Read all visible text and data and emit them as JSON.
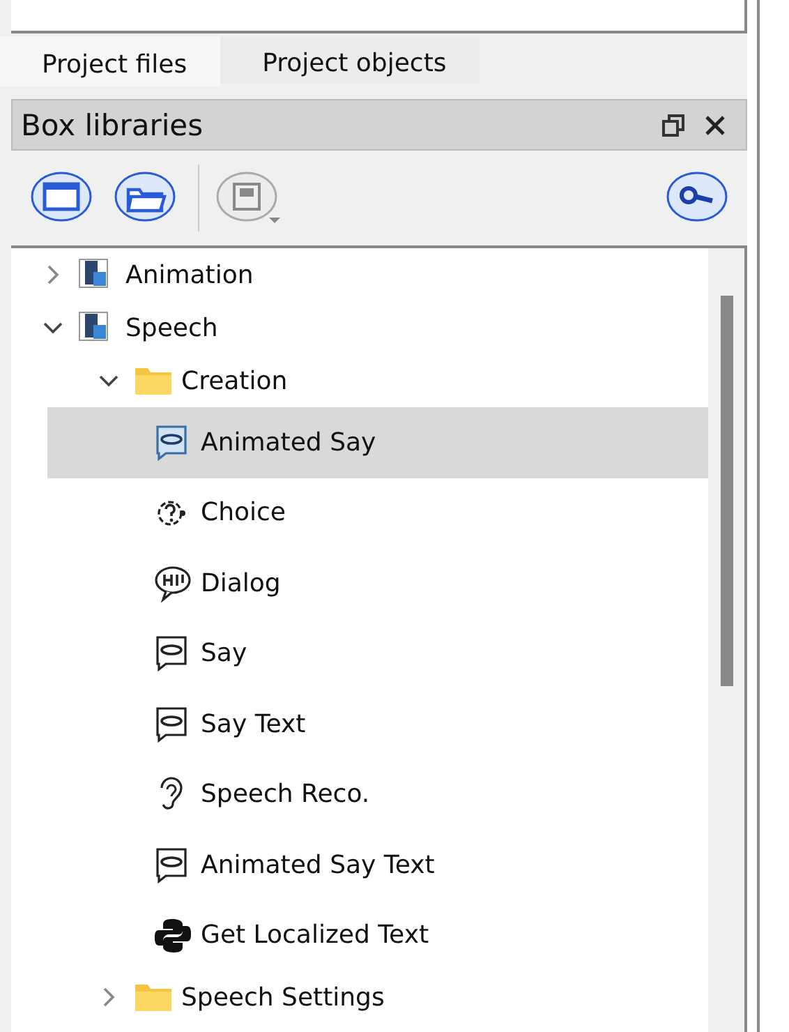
{
  "tabs": [
    {
      "label": "Project files",
      "selected": true
    },
    {
      "label": "Project objects",
      "selected": false
    }
  ],
  "panel": {
    "title": "Box libraries"
  },
  "toolbar": [
    {
      "kind": "new",
      "disabled": false
    },
    {
      "kind": "open",
      "disabled": false
    },
    {
      "kind": "save",
      "disabled": true
    },
    {
      "kind": "search",
      "disabled": false
    }
  ],
  "tree": {
    "items": [
      {
        "label": "Animation",
        "kind": "library",
        "expanded": false,
        "selected": false
      },
      {
        "label": "Speech",
        "kind": "library",
        "expanded": true,
        "selected": false,
        "children": [
          {
            "label": "Creation",
            "kind": "folder",
            "expanded": true,
            "selected": false,
            "children": [
              {
                "label": "Animated Say",
                "kind": "say-animated",
                "selected": true
              },
              {
                "label": "Choice",
                "kind": "choice",
                "selected": false
              },
              {
                "label": "Dialog",
                "kind": "dialog",
                "selected": false
              },
              {
                "label": "Say",
                "kind": "say",
                "selected": false
              },
              {
                "label": "Say Text",
                "kind": "say",
                "selected": false
              },
              {
                "label": "Speech Reco.",
                "kind": "ear",
                "selected": false
              },
              {
                "label": "Animated Say Text",
                "kind": "say",
                "selected": false
              },
              {
                "label": "Get Localized Text",
                "kind": "python",
                "selected": false
              }
            ]
          },
          {
            "label": "Speech Settings",
            "kind": "folder",
            "expanded": false,
            "selected": false
          }
        ]
      }
    ]
  }
}
